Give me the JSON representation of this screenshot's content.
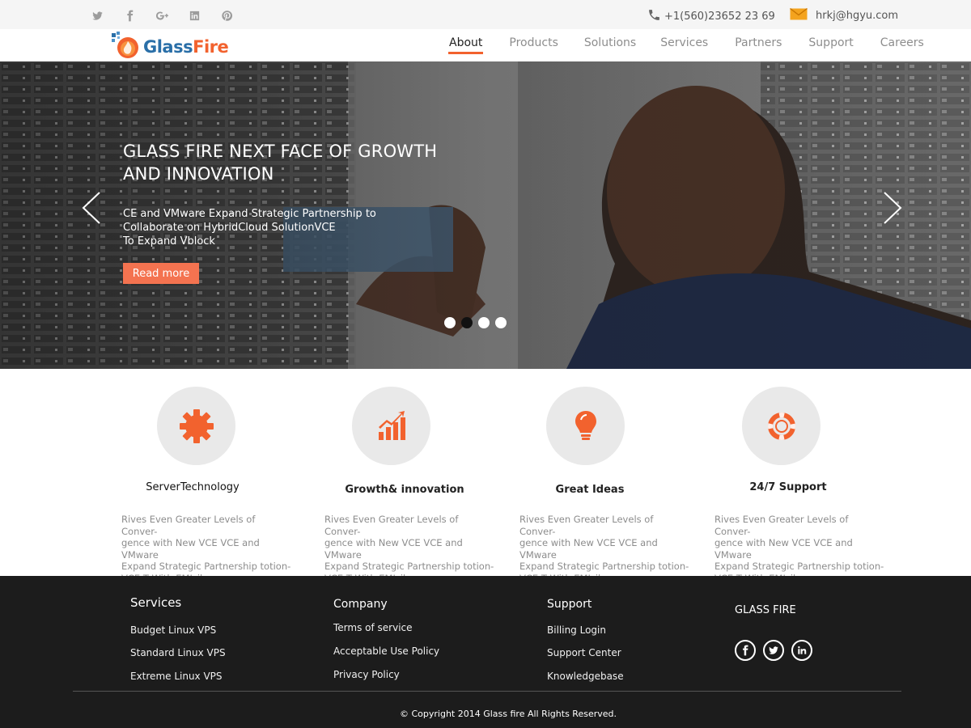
{
  "topbar": {
    "social": [
      "twitter-icon",
      "facebook-icon",
      "google-plus-icon",
      "linkedin-icon",
      "pinterest-icon"
    ],
    "phone": "+1(560)23652 23 69",
    "email": "hrkj@hgyu.com"
  },
  "header": {
    "logo_glass": "Glass",
    "logo_fire": "Fire",
    "nav": [
      {
        "label": "About",
        "active": true
      },
      {
        "label": "Products"
      },
      {
        "label": "Solutions"
      },
      {
        "label": "Services"
      },
      {
        "label": "Partners"
      },
      {
        "label": "Support"
      },
      {
        "label": "Careers"
      }
    ]
  },
  "hero": {
    "title": "GLASS FIRE NEXT FACE OF GROWTH AND INNOVATION",
    "desc_lines": [
      "CE and VMware Expand Strategic Partnership to",
      "Collaborate on HybridCloud SolutionVCE",
      "To Expand Vblock"
    ],
    "button": "Read more",
    "slides": 4,
    "active_slide": 2
  },
  "features": [
    {
      "icon": "gear-icon",
      "title": "ServerTechnology",
      "desc": [
        "Rives Even Greater Levels of Conver-",
        "gence with New VCE VCE and VMware",
        "Expand Strategic Partnership totion-",
        "VCE T With EMIsilon"
      ]
    },
    {
      "icon": "growth-chart-icon",
      "title": "Growth& innovation",
      "desc": [
        "Rives Even Greater Levels of Conver-",
        "gence with New VCE VCE and VMware",
        "Expand Strategic Partnership totion-",
        "VCE T With EMIsilon"
      ]
    },
    {
      "icon": "lightbulb-icon",
      "title": "Great Ideas",
      "desc": [
        "Rives Even Greater Levels of Conver-",
        "gence with New VCE VCE and VMware",
        "Expand Strategic Partnership totion-",
        "VCE T With EMIsilon"
      ]
    },
    {
      "icon": "lifebuoy-icon",
      "title": "24/7 Support",
      "desc": [
        "Rives Even Greater Levels of Conver-",
        "gence with New VCE VCE and VMware",
        "Expand Strategic Partnership totion-",
        "VCE T With EMIsilon"
      ]
    }
  ],
  "footer": {
    "services": {
      "heading": "Services",
      "links": [
        "Budget Linux VPS",
        "Standard Linux VPS",
        "Extreme Linux VPS"
      ]
    },
    "company": {
      "heading": "Company",
      "links": [
        "Terms of service",
        "Acceptable Use Policy",
        "Privacy Policy"
      ]
    },
    "support": {
      "heading": "Support",
      "links": [
        "Billing Login",
        "Support Center",
        "Knowledgebase"
      ]
    },
    "brand": "GLASS FIRE",
    "social": [
      "facebook-icon",
      "twitter-icon",
      "linkedin-icon"
    ],
    "copyright": "© Copyright 2014 Glass fire All Rights Reserved."
  },
  "colors": {
    "accent": "#f2622e",
    "footer_bg": "#1c1c1c",
    "topbar_bg": "#f5f5f5"
  }
}
